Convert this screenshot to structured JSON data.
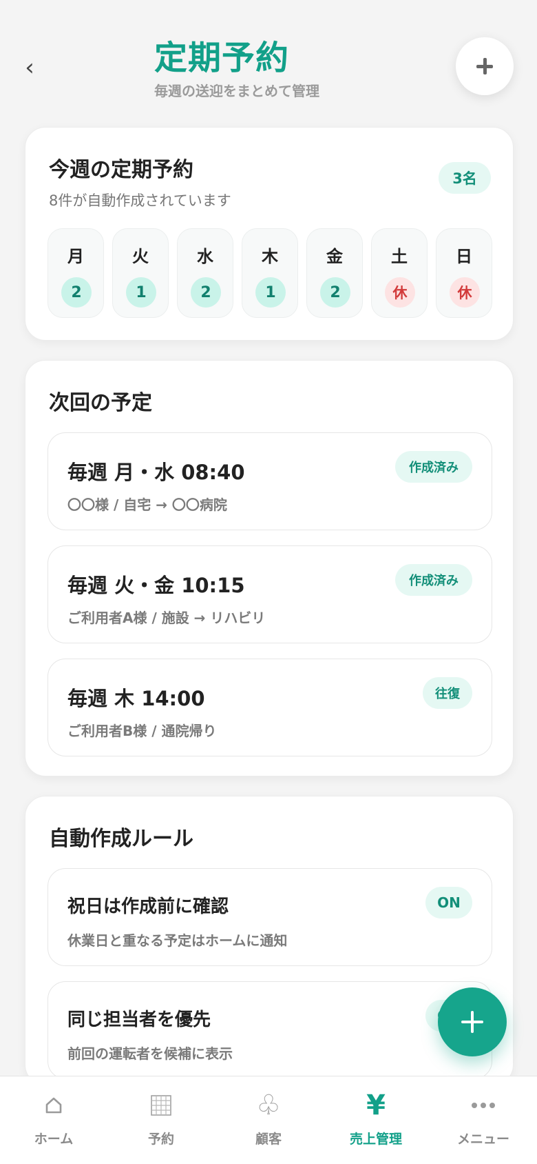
{
  "header": {
    "back_icon": "‹",
    "title": "定期予約",
    "subtitle": "毎週の送迎をまとめて管理",
    "add_icon": "plus-icon"
  },
  "week": {
    "title": "今週の定期予約",
    "subtitle": "8件が自動作成されています",
    "badge": "3名",
    "days": [
      {
        "label": "月",
        "count": "2",
        "off": false
      },
      {
        "label": "火",
        "count": "1",
        "off": false
      },
      {
        "label": "水",
        "count": "2",
        "off": false
      },
      {
        "label": "木",
        "count": "1",
        "off": false
      },
      {
        "label": "金",
        "count": "2",
        "off": false
      },
      {
        "label": "土",
        "count": "休",
        "off": true
      },
      {
        "label": "日",
        "count": "休",
        "off": true
      }
    ]
  },
  "schedule": {
    "title": "次回の予定",
    "items": [
      {
        "title": "毎週 月・水 08:40",
        "sub": "〇〇様 / 自宅 → 〇〇病院",
        "badge": "作成済み"
      },
      {
        "title": "毎週 火・金 10:15",
        "sub": "ご利用者A様 / 施設 → リハビリ",
        "badge": "作成済み"
      },
      {
        "title": "毎週 木 14:00",
        "sub": "ご利用者B様 / 通院帰り",
        "badge": "往復"
      }
    ]
  },
  "rules": {
    "title": "自動作成ルール",
    "items": [
      {
        "title": "祝日は作成前に確認",
        "sub": "休業日と重なる予定はホームに通知",
        "badge": "ON"
      },
      {
        "title": "同じ担当者を優先",
        "sub": "前回の運転者を候補に表示",
        "badge": "ON"
      }
    ]
  },
  "fab": {
    "icon": "plus-icon"
  },
  "nav": {
    "items": [
      {
        "label": "ホーム",
        "icon": "home-icon",
        "active": false
      },
      {
        "label": "予約",
        "icon": "calendar-grid-icon",
        "active": false
      },
      {
        "label": "顧客",
        "icon": "club-icon",
        "active": false
      },
      {
        "label": "売上管理",
        "icon": "yen-icon",
        "glyph": "¥",
        "active": true
      },
      {
        "label": "メニュー",
        "icon": "more-dots-icon",
        "active": false
      }
    ]
  },
  "colors": {
    "accent": "#12a089",
    "badge_bg": "#e5f8f3",
    "count_bg": "#c9f3e9",
    "off_bg": "#fde3e3",
    "off_text": "#d23a3a"
  }
}
